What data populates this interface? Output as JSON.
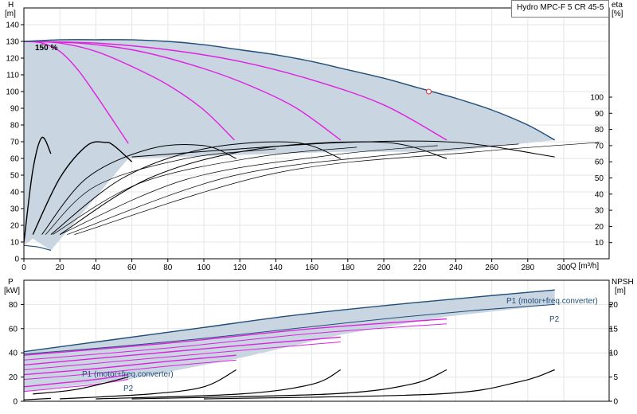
{
  "chart_data": [
    {
      "type": "line",
      "title": "Hydro MPC-F 5 CR 45-5",
      "xlabel": "Q [m³/h]",
      "ylabel": "H\n[m]",
      "y2label": "eta\n[%]",
      "xlim": [
        0,
        300
      ],
      "ylim": [
        0,
        150
      ],
      "y2lim": [
        0,
        100
      ],
      "x_ticks": [
        "0",
        "20",
        "40",
        "60",
        "80",
        "100",
        "120",
        "140",
        "160",
        "180",
        "200",
        "220",
        "240",
        "260",
        "280",
        "300"
      ],
      "y_ticks": [
        "0",
        "10",
        "20",
        "30",
        "40",
        "50",
        "60",
        "70",
        "80",
        "90",
        "100",
        "110",
        "120",
        "130",
        "140"
      ],
      "y2_ticks": [
        "10",
        "20",
        "30",
        "40",
        "50",
        "60",
        "70",
        "80",
        "90",
        "100"
      ],
      "annotation": "150 %",
      "grid": true,
      "colors": {
        "envelope_fill": "#c9d5e1",
        "envelope_line": "#1f4e79",
        "magenta": "#e020e0",
        "black": "#000000",
        "duty_point": "#e03030"
      },
      "envelope": {
        "name": "",
        "x": [
          0,
          20,
          40,
          60,
          80,
          100,
          120,
          140,
          160,
          180,
          200,
          220,
          240,
          260,
          280,
          295
        ],
        "y": [
          130,
          131,
          131,
          131,
          130,
          128,
          125,
          122,
          118,
          113,
          108,
          102,
          96,
          89,
          80,
          71
        ]
      },
      "head_curves": [
        {
          "x": [
            0,
            10,
            20,
            30,
            40,
            50,
            58
          ],
          "y": [
            130,
            129,
            124,
            113,
            98,
            82,
            69
          ]
        },
        {
          "x": [
            0,
            20,
            40,
            60,
            80,
            100,
            117
          ],
          "y": [
            130,
            129,
            124,
            115,
            104,
            89,
            71
          ]
        },
        {
          "x": [
            0,
            30,
            60,
            90,
            120,
            150,
            176
          ],
          "y": [
            130,
            129,
            125,
            117,
            106,
            91,
            71
          ]
        },
        {
          "x": [
            0,
            40,
            80,
            120,
            160,
            200,
            235
          ],
          "y": [
            130,
            129,
            125,
            118,
            107,
            92,
            71
          ]
        }
      ],
      "efficiency_curves": [
        {
          "x": [
            0,
            5,
            10,
            15
          ],
          "y": [
            10,
            55,
            75,
            65
          ]
        },
        {
          "x": [
            5,
            20,
            35,
            45,
            50,
            60
          ],
          "y": [
            15,
            50,
            70,
            72,
            70,
            60
          ]
        },
        {
          "x": [
            10,
            35,
            70,
            100,
            118
          ],
          "y": [
            15,
            50,
            68,
            70,
            62
          ]
        },
        {
          "x": [
            15,
            55,
            100,
            150,
            176
          ],
          "y": [
            15,
            50,
            68,
            72,
            62
          ]
        },
        {
          "x": [
            20,
            70,
            130,
            200,
            235
          ],
          "y": [
            15,
            50,
            68,
            72,
            62
          ]
        },
        {
          "x": [
            60,
            120,
            180,
            240,
            295
          ],
          "y": [
            63,
            68,
            72,
            72,
            63
          ]
        }
      ],
      "duty_point": {
        "x": 225,
        "y": 100
      }
    },
    {
      "type": "line",
      "ylabel": "P\n[kW]",
      "y2label": "NPSH\n[m]",
      "xlim": [
        0,
        300
      ],
      "ylim": [
        0,
        100
      ],
      "y2lim": [
        0,
        25
      ],
      "y_ticks": [
        "0",
        "20",
        "40",
        "60",
        "80"
      ],
      "y2_ticks": [
        "0",
        "5",
        "10",
        "15",
        "20"
      ],
      "grid": true,
      "labels": {
        "p1_upper": "P1 (motor+freq.converter)",
        "p2_upper": "P2",
        "p1_lower": "P1 (motor+freq.converter)",
        "p2_lower": "P2"
      },
      "envelope": {
        "x": [
          0,
          50,
          100,
          150,
          200,
          250,
          295
        ],
        "upper": [
          41,
          51,
          61,
          71,
          79,
          86,
          92
        ],
        "lower": [
          39,
          45,
          52,
          60,
          68,
          75,
          80
        ]
      },
      "power_curves": [
        {
          "x": [
            0,
            20,
            40,
            58
          ],
          "y": [
            12,
            15,
            18,
            22
          ]
        },
        {
          "x": [
            0,
            40,
            80,
            118
          ],
          "y": [
            22,
            27,
            33,
            38
          ]
        },
        {
          "x": [
            0,
            60,
            120,
            176
          ],
          "y": [
            30,
            38,
            46,
            53
          ]
        },
        {
          "x": [
            0,
            80,
            160,
            235
          ],
          "y": [
            38,
            48,
            60,
            68
          ]
        }
      ],
      "npsh_curves": [
        {
          "x": [
            0,
            15
          ],
          "y": [
            0.3,
            0.6
          ]
        },
        {
          "x": [
            5,
            30,
            58
          ],
          "y": [
            1.5,
            2.5,
            5
          ]
        },
        {
          "x": [
            20,
            70,
            100,
            118
          ],
          "y": [
            0.5,
            1.5,
            3,
            6.5
          ]
        },
        {
          "x": [
            40,
            120,
            160,
            176
          ],
          "y": [
            0.5,
            1.5,
            3.5,
            6.5
          ]
        },
        {
          "x": [
            60,
            170,
            215,
            235
          ],
          "y": [
            0.5,
            1.5,
            3.5,
            6.5
          ]
        },
        {
          "x": [
            100,
            230,
            275,
            295
          ],
          "y": [
            0.5,
            1.5,
            4,
            6.5
          ]
        }
      ]
    }
  ]
}
